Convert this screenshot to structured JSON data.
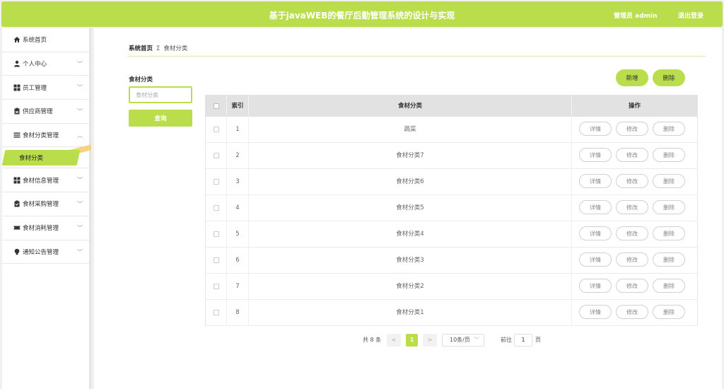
{
  "header": {
    "title": "基于javaWEB的餐厅后勤管理系统的设计与实现",
    "user": "管理员 admin",
    "logout": "退出登录"
  },
  "sidebar": {
    "items": [
      {
        "label": "系统首页",
        "icon": "home-icon"
      },
      {
        "label": "个人中心",
        "icon": "user-icon"
      },
      {
        "label": "员工管理",
        "icon": "grid-icon"
      },
      {
        "label": "供应商管理",
        "icon": "clipboard-icon"
      },
      {
        "label": "食材分类管理",
        "icon": "list-icon"
      },
      {
        "label": "食材信息管理",
        "icon": "grid-icon"
      },
      {
        "label": "食材采购管理",
        "icon": "clipboard-check-icon"
      },
      {
        "label": "食材消耗管理",
        "icon": "ticket-icon"
      },
      {
        "label": "通知公告管理",
        "icon": "bulb-icon"
      }
    ],
    "sub_active": "食材分类"
  },
  "breadcrumb": {
    "home": "系统首页",
    "separator": "Σ",
    "current": "食材分类"
  },
  "search": {
    "label": "食材分类",
    "placeholder": "食材分类",
    "button": "查询"
  },
  "actions": {
    "add": "新增",
    "delete": "删除"
  },
  "table": {
    "headers": {
      "index": "索引",
      "category": "食材分类",
      "ops": "操作"
    },
    "op_labels": {
      "detail": "详情",
      "edit": "修改",
      "delete": "删除"
    },
    "rows": [
      {
        "index": "1",
        "category": "蔬菜"
      },
      {
        "index": "2",
        "category": "食材分类7"
      },
      {
        "index": "3",
        "category": "食材分类6"
      },
      {
        "index": "4",
        "category": "食材分类5"
      },
      {
        "index": "5",
        "category": "食材分类4"
      },
      {
        "index": "6",
        "category": "食材分类3"
      },
      {
        "index": "7",
        "category": "食材分类2"
      },
      {
        "index": "8",
        "category": "食材分类1"
      }
    ]
  },
  "pagination": {
    "total": "共 8 条",
    "prev": "<",
    "current": "1",
    "next": ">",
    "page_size": "10条/页",
    "goto_label": "前往",
    "goto_value": "1",
    "goto_unit": "页"
  },
  "colors": {
    "accent": "#b9dd4b",
    "header_bg": "#e2e2e2"
  }
}
